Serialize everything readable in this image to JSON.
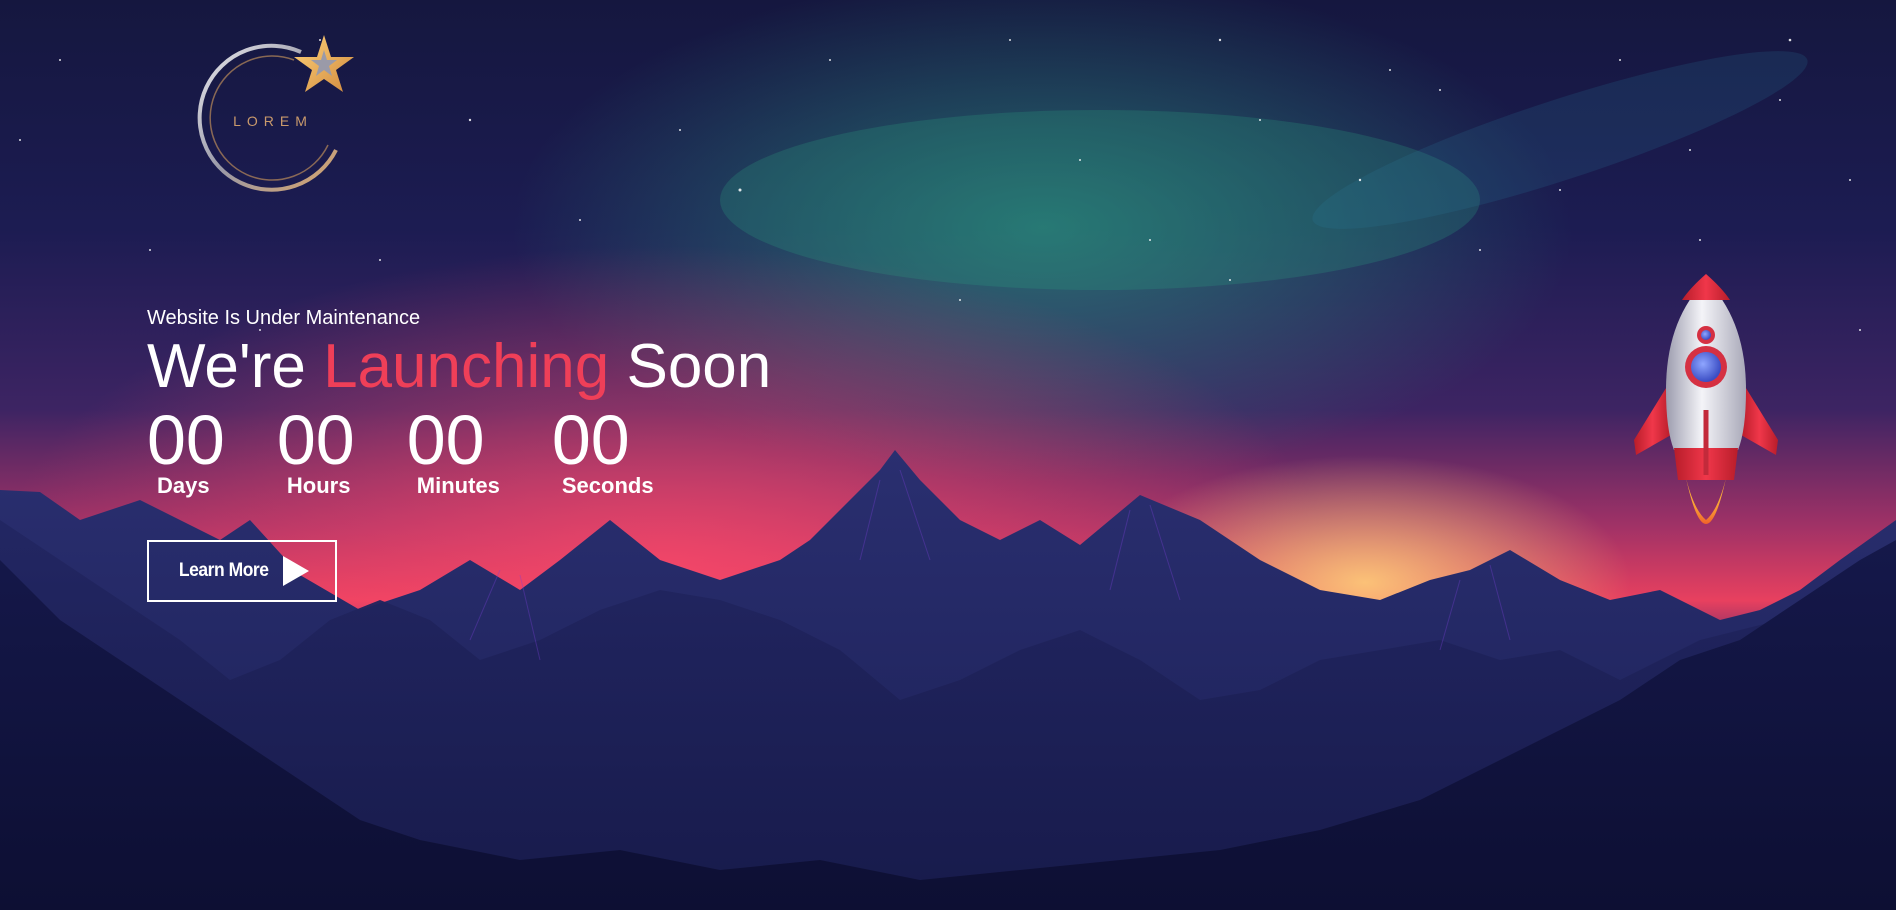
{
  "logo": {
    "text": "LOREM"
  },
  "hero": {
    "subtitle": "Website Is Under Maintenance",
    "headline_part1": "We're ",
    "headline_accent": "Launching",
    "headline_part2": " Soon"
  },
  "countdown": [
    {
      "value": "00",
      "label": "Days"
    },
    {
      "value": "00",
      "label": "Hours"
    },
    {
      "value": "00",
      "label": "Minutes"
    },
    {
      "value": "00",
      "label": "Seconds"
    }
  ],
  "cta": {
    "label": "Learn More"
  },
  "colors": {
    "accent": "#ef3f58",
    "background": "#14163f",
    "text": "#ffffff"
  }
}
